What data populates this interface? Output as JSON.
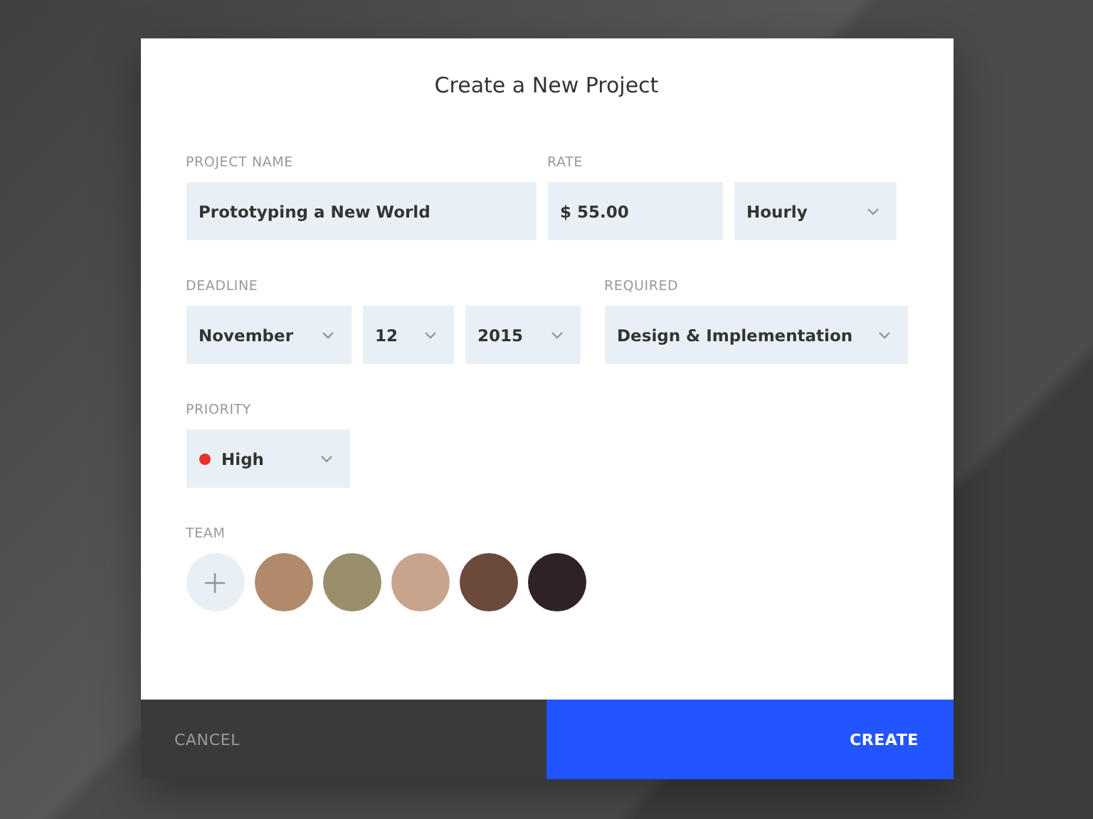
{
  "dialog": {
    "title": "Create a New Project"
  },
  "project_name": {
    "label": "PROJECT NAME",
    "value": "Prototyping a New World"
  },
  "rate": {
    "label": "RATE",
    "value": "$ 55.00",
    "unit": "Hourly"
  },
  "deadline": {
    "label": "DEADLINE",
    "month": "November",
    "day": "12",
    "year": "2015"
  },
  "required": {
    "label": "REQUIRED",
    "value": "Design & Implementation"
  },
  "priority": {
    "label": "PRIORITY",
    "value": "High",
    "color": "#e5322d"
  },
  "team": {
    "label": "TEAM",
    "members": [
      {
        "kind": "avatar",
        "color": "#b08a6a"
      },
      {
        "kind": "avatar",
        "color": "#9a8f6a"
      },
      {
        "kind": "avatar",
        "color": "#c9a48c"
      },
      {
        "kind": "avatar",
        "color": "#6b4a3c"
      },
      {
        "kind": "avatar",
        "color": "#2e2228"
      }
    ]
  },
  "buttons": {
    "cancel": "CANCEL",
    "create": "CREATE"
  }
}
